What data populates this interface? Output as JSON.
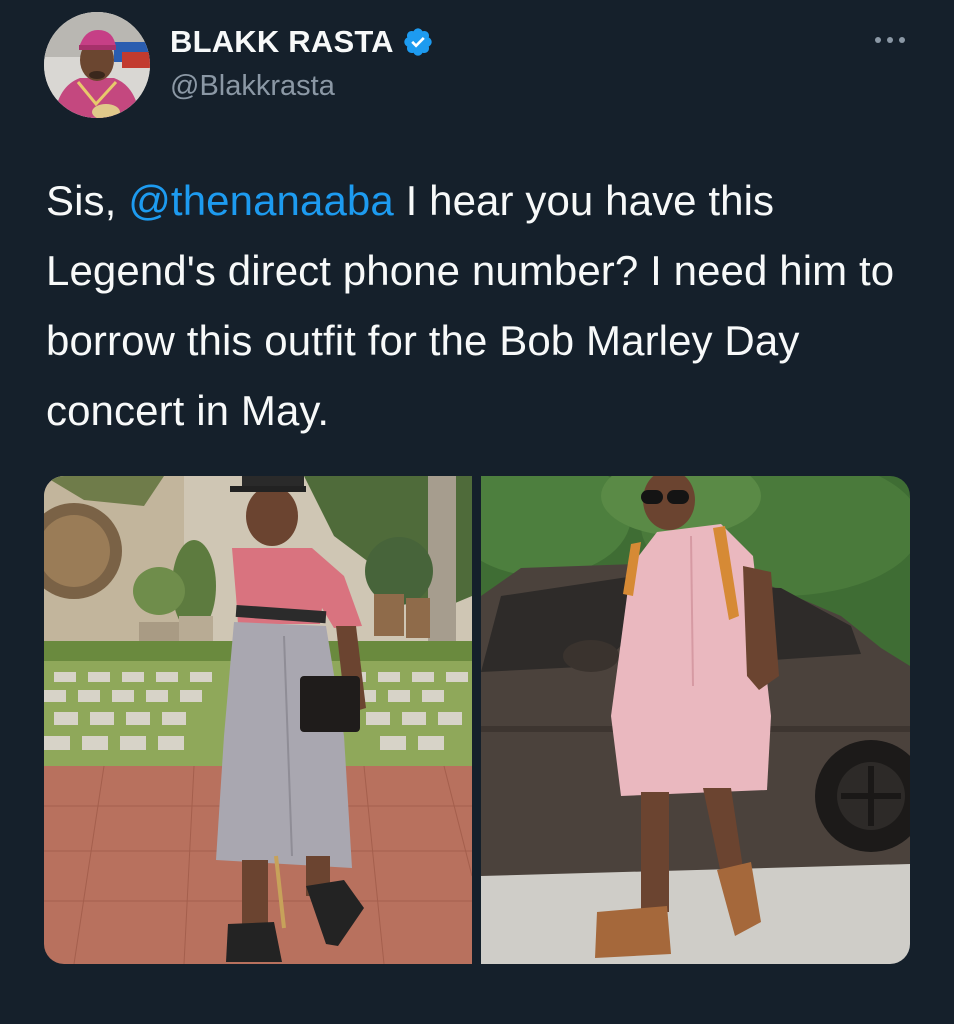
{
  "author": {
    "display_name": "BLAKK RASTA",
    "handle": "@Blakkrasta",
    "verified": true,
    "avatar_icon": "profile-photo"
  },
  "tweet": {
    "text_parts": [
      {
        "text": "Sis, ",
        "type": "text"
      },
      {
        "text": "@thenanaaba",
        "type": "mention"
      },
      {
        "text": " I hear you have this Legend's direct phone number? I need him to borrow this outfit for the Bob Marley Day concert in May.",
        "type": "text"
      }
    ]
  },
  "media": {
    "count": 2
  },
  "icons": {
    "more": "more-options-icon",
    "verified": "verified-badge-icon"
  },
  "colors": {
    "background": "#15202b",
    "text": "#f7f9f9",
    "secondary_text": "#8b98a5",
    "accent": "#1d9bf0"
  }
}
